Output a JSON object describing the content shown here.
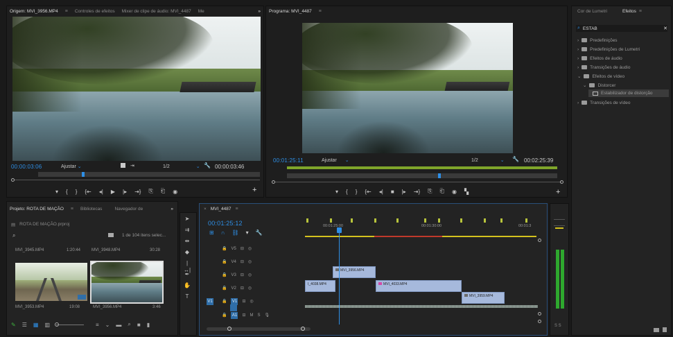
{
  "source_monitor": {
    "tabs": [
      "Origem: MVI_3956.MP4",
      "Controles de efeitos",
      "Mixer de clipe de áudio: MVI_4487",
      "Me"
    ],
    "more": "»",
    "timecode": "00:00:03:06",
    "fit": "Ajustar",
    "resolution": "1/2",
    "duration": "00:00:03:46"
  },
  "program_monitor": {
    "tab": "Programa: MVI_4487",
    "timecode": "00:01:25:11",
    "fit": "Ajustar",
    "resolution": "1/2",
    "duration": "00:02:25:39"
  },
  "effects_panel": {
    "tabs": [
      "Cor de Lumetri",
      "Efeitos"
    ],
    "search_value": "ESTAB",
    "items": [
      "Predefinições",
      "Predefinições de Lumetri",
      "Efeitos de áudio",
      "Transições de áudio",
      "Efeitos de vídeo",
      "Distorcer",
      "Estabilizador de distorção",
      "Transições de vídeo"
    ]
  },
  "project_panel": {
    "tabs": [
      "Projeto: ROTA DE MAÇÃO",
      "Bibliotecas",
      "Navegador de",
      "»"
    ],
    "project_file": "ROTA DE MAÇÃO.prproj",
    "selection_info": "1 de 104 itens selec...",
    "clips": [
      {
        "name": "MVI_3945.MP4",
        "duration": "1:20:44"
      },
      {
        "name": "MVI_3948.MP4",
        "duration": "30:28"
      },
      {
        "name": "MVI_3953.MP4",
        "duration": "19:08"
      },
      {
        "name": "MVI_3956.MP4",
        "duration": "3:46"
      }
    ]
  },
  "timeline": {
    "sequence_tab": "MVI_4487",
    "timecode": "00:01:25:12",
    "ruler_labels": [
      "00:01:25:00",
      "00:01:30:00",
      "00:01:3"
    ],
    "tracks": [
      "V5",
      "V4",
      "V3",
      "V2",
      "V1",
      "A1"
    ],
    "source_patch": [
      "V1",
      "A1"
    ],
    "clips": [
      "MVI_3956.MP4",
      "I_4038.MP4",
      "MVI_4033.MP4",
      "MVI_3959.MP4"
    ],
    "audio_controls": [
      "M",
      "S"
    ]
  },
  "audio_meter": {
    "label": "S S"
  },
  "colors": {
    "accent": "#2e8fe6",
    "clip": "#a6b9dc",
    "marker": "#b8c43c",
    "meter": "#2ea82e",
    "work_area_yellow": "#d4c21d",
    "render_red": "#c0392b"
  }
}
